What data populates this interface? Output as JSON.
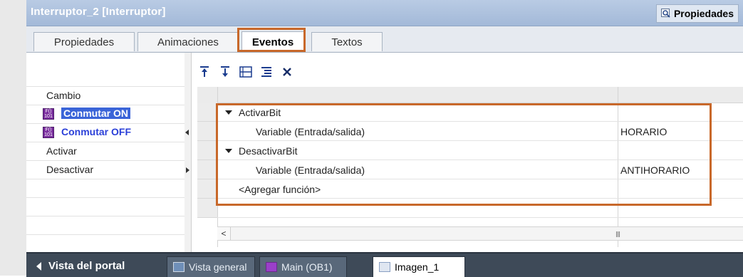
{
  "window": {
    "title": "Interruptor_2 [Interruptor]",
    "properties_button": "Propiedades"
  },
  "tabs": [
    {
      "label": "Propiedades"
    },
    {
      "label": "Animaciones"
    },
    {
      "label": "Eventos",
      "active": true
    },
    {
      "label": "Textos"
    }
  ],
  "events": [
    {
      "label": "Cambio",
      "has_icon": false
    },
    {
      "label": "Conmutar ON",
      "has_icon": true,
      "selected": true
    },
    {
      "label": "Conmutar OFF",
      "has_icon": true
    },
    {
      "label": "Activar",
      "has_icon": false
    },
    {
      "label": "Desactivar",
      "has_icon": false
    }
  ],
  "toolbar": {
    "icons": [
      "move-up-icon",
      "move-down-icon",
      "collapse-all-icon",
      "expand-all-icon",
      "delete-icon"
    ]
  },
  "function_list": [
    {
      "name": "ActivarBit",
      "param": "Variable (Entrada/salida)",
      "value": "HORARIO"
    },
    {
      "name": "DesactivarBit",
      "param": "Variable (Entrada/salida)",
      "value": "ANTIHORARIO"
    }
  ],
  "add_function": "<Agregar función>",
  "bottom": {
    "portal": "Vista del portal",
    "tabs": [
      {
        "label": "Vista general",
        "icon": "overview-icon"
      },
      {
        "label": "Main (OB1)",
        "icon": "block-icon"
      },
      {
        "label": "Imagen_1",
        "icon": "screen-icon",
        "active": true
      }
    ]
  },
  "colors": {
    "highlight": "#c8682a",
    "selection": "#3a64d8",
    "event_active": "#2a3fd8"
  }
}
